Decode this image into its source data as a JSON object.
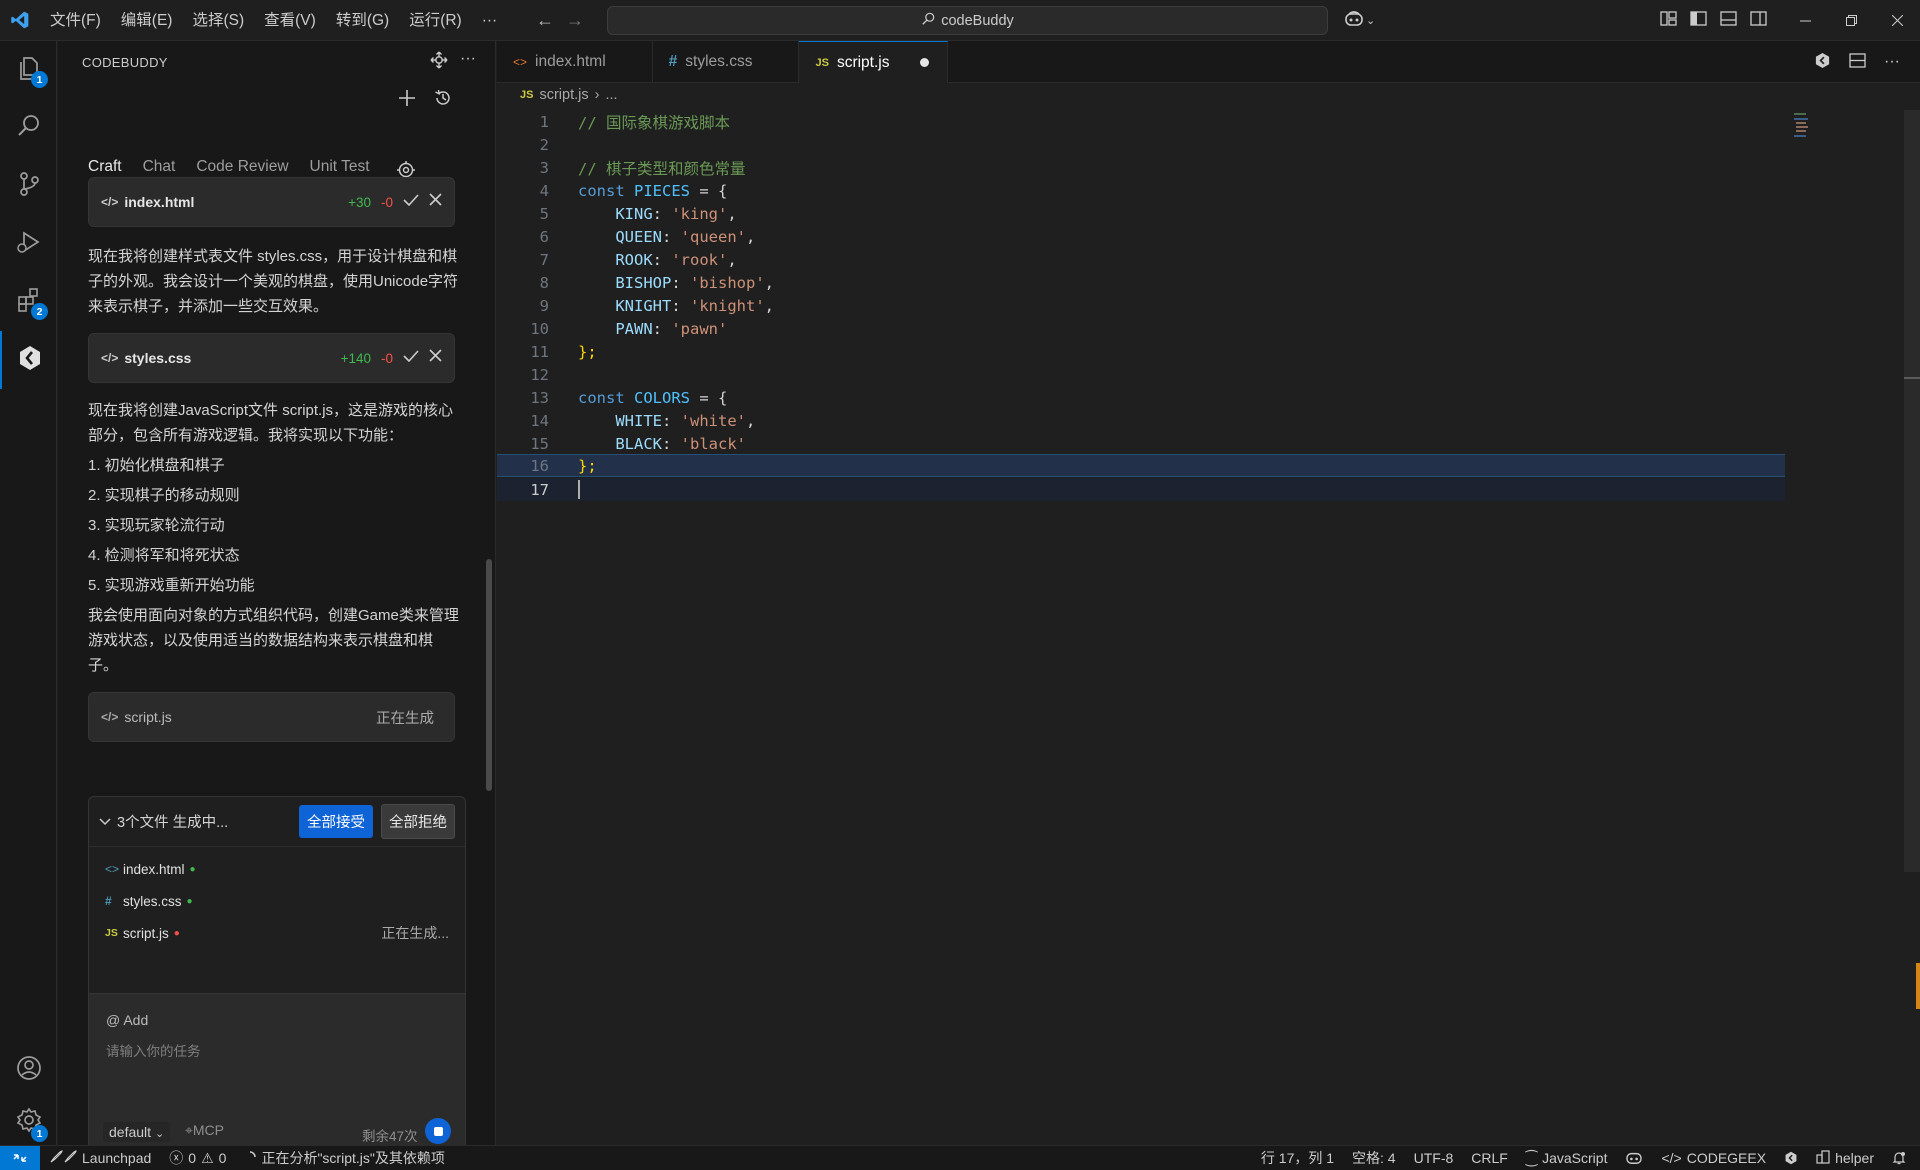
{
  "titlebar": {
    "menus": [
      "文件(F)",
      "编辑(E)",
      "选择(S)",
      "查看(V)",
      "转到(G)",
      "运行(R)",
      "···"
    ],
    "search_text": "codeBuddy"
  },
  "activity": {
    "explorer_badge": "1",
    "extensions_badge": "2",
    "settings_badge": "1"
  },
  "sidebar": {
    "title": "CODEBUDDY",
    "tabs": [
      "Craft",
      "Chat",
      "Code Review",
      "Unit Test"
    ],
    "cards": [
      {
        "name": "index.html",
        "added": "+30",
        "removed": "-0"
      },
      {
        "name": "styles.css",
        "added": "+140",
        "removed": "-0"
      }
    ],
    "pending_card": {
      "name": "script.js",
      "status": "正在生成"
    },
    "messages": {
      "m1": "现在我将创建样式表文件 styles.css，用于设计棋盘和棋子的外观。我会设计一个美观的棋盘，使用Unicode字符来表示棋子，并添加一些交互效果。",
      "m2_intro": "现在我将创建JavaScript文件 script.js，这是游戏的核心部分，包含所有游戏逻辑。我将实现以下功能：",
      "m2_items": [
        "1. 初始化棋盘和棋子",
        "2. 实现棋子的移动规则",
        "3. 实现玩家轮流行动",
        "4. 检测将军和将死状态",
        "5. 实现游戏重新开始功能"
      ],
      "m2_outro": "我会使用面向对象的方式组织代码，创建Game类来管理游戏状态，以及使用适当的数据结构来表示棋盘和棋子。"
    },
    "generation": {
      "title": "3个文件 生成中...",
      "accept_all": "全部接受",
      "reject_all": "全部拒绝",
      "files": [
        {
          "icon": "<>",
          "name": "index.html"
        },
        {
          "icon": "#",
          "name": "styles.css"
        },
        {
          "icon": "JS",
          "name": "script.js",
          "status": "正在生成..."
        }
      ]
    },
    "input": {
      "add_label": "@ Add",
      "placeholder": "请输入你的任务",
      "model": "default",
      "mcp": "MCP",
      "remaining": "剩余47次"
    }
  },
  "editor": {
    "tabs": [
      {
        "icon": "<>",
        "name": "index.html"
      },
      {
        "icon": "#",
        "name": "styles.css"
      },
      {
        "icon": "JS",
        "name": "script.js"
      }
    ],
    "breadcrumb": [
      "script.js",
      "..."
    ],
    "line_numbers": [
      "1",
      "2",
      "3",
      "4",
      "5",
      "6",
      "7",
      "8",
      "9",
      "10",
      "11",
      "12",
      "13",
      "14",
      "15",
      "16",
      "17"
    ],
    "code": {
      "c1": "// 国际象棋游戏脚本",
      "c3": "// 棋子类型和颜色常量",
      "const_kw": "const",
      "pieces_name": "PIECES",
      "colors_name": "COLORS",
      "eq_open": " = {",
      "close": "};",
      "king_key": "KING",
      "king_val": "'king'",
      "queen_key": "QUEEN",
      "queen_val": "'queen'",
      "rook_key": "ROOK",
      "rook_val": "'rook'",
      "bishop_key": "BISHOP",
      "bishop_val": "'bishop'",
      "knight_key": "KNIGHT",
      "knight_val": "'knight'",
      "pawn_key": "PAWN",
      "pawn_val": "'pawn'",
      "white_key": "WHITE",
      "white_val": "'white'",
      "black_key": "BLACK",
      "black_val": "'black'"
    }
  },
  "statusbar": {
    "launchpad": "Launchpad",
    "errors": "0",
    "warnings": "0",
    "analyzing": "正在分析\"script.js\"及其依赖项",
    "position": "行 17，列 1",
    "spaces": "空格: 4",
    "encoding": "UTF-8",
    "eol": "CRLF",
    "language": "JavaScript",
    "codegeex": "CODEGEEX",
    "helper": "helper"
  }
}
